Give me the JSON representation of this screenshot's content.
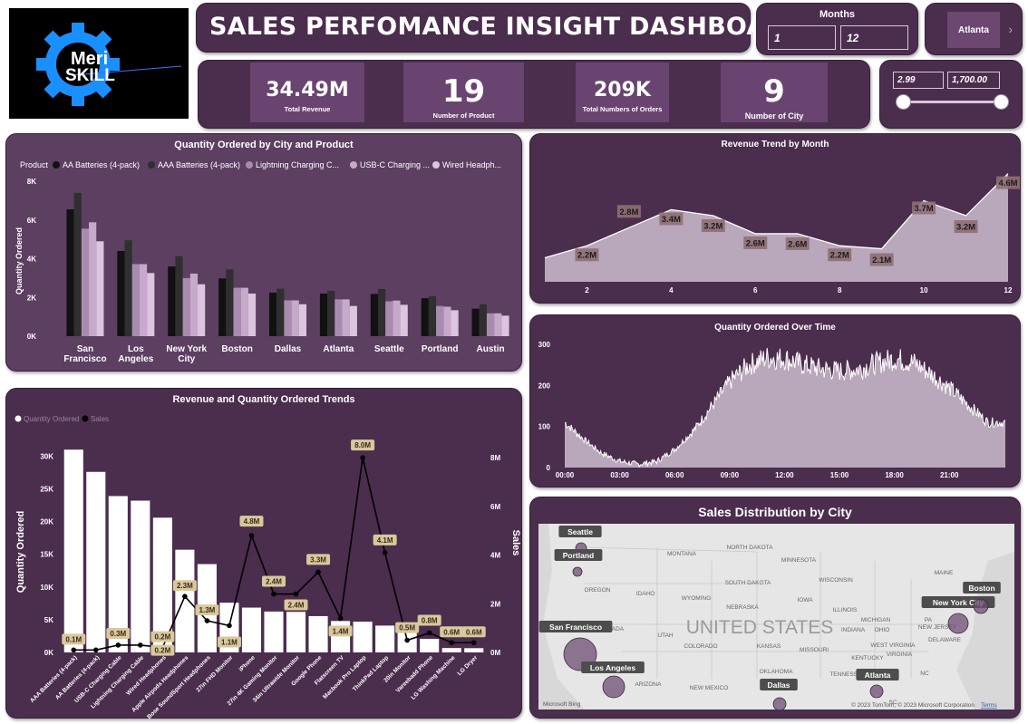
{
  "header": {
    "logo_line1": "Meri",
    "logo_line2": "SKILL",
    "title": "SALES PERFOMANCE INSIGHT DASHBOARD"
  },
  "filters": {
    "months_label": "Months",
    "month_from": "1",
    "month_to": "12",
    "city": "Atlanta",
    "price_min": "2.99",
    "price_max": "1,700.00"
  },
  "kpis": [
    {
      "value": "34.49M",
      "label": "Total Revenue"
    },
    {
      "value": "19",
      "label": "Number of Product"
    },
    {
      "value": "209K",
      "label": "Total Numbers of Orders"
    },
    {
      "value": "9",
      "label": "Number of City"
    }
  ],
  "colors": {
    "panel_bg": "#4b2d4e",
    "panel_light": "#5d3f62",
    "series": [
      "#111111",
      "#2f2f2f",
      "#a98bb0",
      "#c7a9cc",
      "#dcc6df"
    ],
    "area_fill": "#b9a7bb",
    "label_badge": "#8f6f74",
    "gold_badge": "#d9c89a"
  },
  "chart_data": [
    {
      "type": "bar",
      "title": "Quantity Ordered by City and Product",
      "legend_title": "Product",
      "ylabel": "Quantity Ordered",
      "ylim": [
        0,
        8000
      ],
      "yticks": [
        "0K",
        "2K",
        "4K",
        "6K",
        "8K"
      ],
      "categories": [
        "San Francisco",
        "Los Angeles",
        "New York City",
        "Boston",
        "Dallas",
        "Atlanta",
        "Seattle",
        "Portland",
        "Austin"
      ],
      "series": [
        {
          "name": "AA Batteries (4-pack)",
          "values": [
            6550,
            4400,
            3600,
            2980,
            2250,
            2200,
            2180,
            1960,
            1420
          ]
        },
        {
          "name": "AAA Batteries (4-pack)",
          "values": [
            7400,
            4950,
            4130,
            3450,
            2450,
            2340,
            2440,
            2060,
            1650
          ]
        },
        {
          "name": "Lightning Charging C...",
          "values": [
            5550,
            3720,
            3000,
            2500,
            1850,
            1900,
            1800,
            1560,
            1180
          ]
        },
        {
          "name": "USB-C Charging ...",
          "values": [
            5880,
            3720,
            3230,
            2500,
            1850,
            1900,
            1840,
            1520,
            1180
          ]
        },
        {
          "name": "Wired Headph...",
          "values": [
            4900,
            3260,
            2680,
            2200,
            1650,
            1560,
            1620,
            1340,
            1060
          ]
        }
      ]
    },
    {
      "type": "area",
      "title": "Revenue Trend by Month",
      "x": [
        1,
        2,
        3,
        4,
        5,
        6,
        7,
        8,
        9,
        10,
        11,
        12
      ],
      "xticks": [
        "2",
        "4",
        "6",
        "8",
        "10",
        "12"
      ],
      "values": [
        1.8,
        2.2,
        2.8,
        3.4,
        3.2,
        2.6,
        2.6,
        2.2,
        2.1,
        3.7,
        3.2,
        4.6
      ],
      "labels": [
        "",
        "2.2M",
        "2.8M",
        "3.4M",
        "3.2M",
        "2.6M",
        "2.6M",
        "2.2M",
        "2.1M",
        "3.7M",
        "3.2M",
        "4.6M"
      ],
      "units": "M"
    },
    {
      "type": "area",
      "title": "Quantity Ordered Over Time",
      "ylim": [
        0,
        300
      ],
      "yticks": [
        "0",
        "100",
        "200",
        "300"
      ],
      "xticks": [
        "00:00",
        "03:00",
        "06:00",
        "09:00",
        "12:00",
        "15:00",
        "18:00",
        "21:00"
      ],
      "hourly_profile": [
        110,
        70,
        35,
        15,
        8,
        15,
        45,
        90,
        150,
        210,
        250,
        268,
        265,
        250,
        240,
        235,
        240,
        255,
        265,
        255,
        225,
        190,
        150,
        110
      ]
    },
    {
      "type": "bar",
      "title": "Revenue and Quantity Ordered Trends",
      "legend": [
        "Quantity Ordered",
        "Sales"
      ],
      "ylabel": "Quantity Ordered",
      "y2label": "Sales",
      "ylim": [
        0,
        32000
      ],
      "yticks": [
        "0K",
        "5K",
        "10K",
        "15K",
        "20K",
        "25K",
        "30K"
      ],
      "y2ticks": [
        "0M",
        "2M",
        "4M",
        "6M",
        "8M"
      ],
      "categories": [
        "AAA Batteries (4-pack)",
        "AA Batteries (4-pack)",
        "USB-C Charging Cable",
        "Lightning Charging Cable",
        "Wired Headphones",
        "Apple Airpods Headphones",
        "Bose SoundSport Headphones",
        "27in FHD Monitor",
        "iPhone",
        "27in 4K Gaming Monitor",
        "34in Ultrawide Monitor",
        "Google Phone",
        "Flatscreen TV",
        "Macbook Pro Laptop",
        "ThinkPad Laptop",
        "20in Monitor",
        "Vareebadd Phone",
        "LG Washing Machine",
        "LG Dryer"
      ],
      "quantity": [
        31000,
        27600,
        23900,
        23200,
        20600,
        15700,
        13500,
        7600,
        6850,
        6250,
        6200,
        5550,
        4800,
        4700,
        4100,
        4100,
        2070,
        670,
        650
      ],
      "sales": [
        0.1,
        0.1,
        0.3,
        0.3,
        0.2,
        2.3,
        1.3,
        1.1,
        4.8,
        2.4,
        2.4,
        3.3,
        1.4,
        8.0,
        4.1,
        0.5,
        0.8,
        0.4,
        0.4
      ],
      "sales_labels": [
        "0.1M",
        "",
        "0.3M",
        "",
        "0.2M",
        "2.3M",
        "1.3M",
        "1.1M",
        "4.8M",
        "2.4M",
        "2.4M",
        "3.3M",
        "1.4M",
        "8.0M",
        "4.1M",
        "0.5M",
        "0.8M",
        "0.6M",
        "0.6M"
      ],
      "sales_labels_extra": [
        "",
        "",
        "",
        "",
        "0.2M",
        "",
        "",
        "",
        "",
        "",
        "",
        "",
        "",
        "",
        "",
        "",
        "",
        "",
        ""
      ]
    }
  ],
  "map": {
    "title": "Sales Distribution by City",
    "country_label": "UNITED STATES",
    "cities": [
      {
        "name": "Seattle"
      },
      {
        "name": "Portland"
      },
      {
        "name": "San Francisco"
      },
      {
        "name": "Los Angeles"
      },
      {
        "name": "Dallas"
      },
      {
        "name": "Atlanta"
      },
      {
        "name": "New York City"
      },
      {
        "name": "Boston"
      }
    ],
    "states": [
      "NORTH DAKOTA",
      "MINNESOTA",
      "MONTANA",
      "SOUTH DAKOTA",
      "WISCONSIN",
      "OREGON",
      "IDAHO",
      "WYOMING",
      "IOWA",
      "MICHIGAN",
      "NEBRASKA",
      "ILLINOIS",
      "INDIANA",
      "OHIO",
      "PA",
      "NEVADA",
      "UTAH",
      "COLORADO",
      "KANSAS",
      "MISSOURI",
      "KENTUCKY",
      "VIRGINIA",
      "WEST VIRGINIA",
      "ARIZONA",
      "NEW MEXICO",
      "OKLAHOMA",
      "TENNESSEE",
      "NC",
      "DELAWARE",
      "NEW JERSEY",
      "MAINE",
      "SC"
    ],
    "attribution": "© 2023 TomTom, © 2023 Microsoft Corporation",
    "terms": "Terms",
    "bing": "Microsoft Bing"
  }
}
